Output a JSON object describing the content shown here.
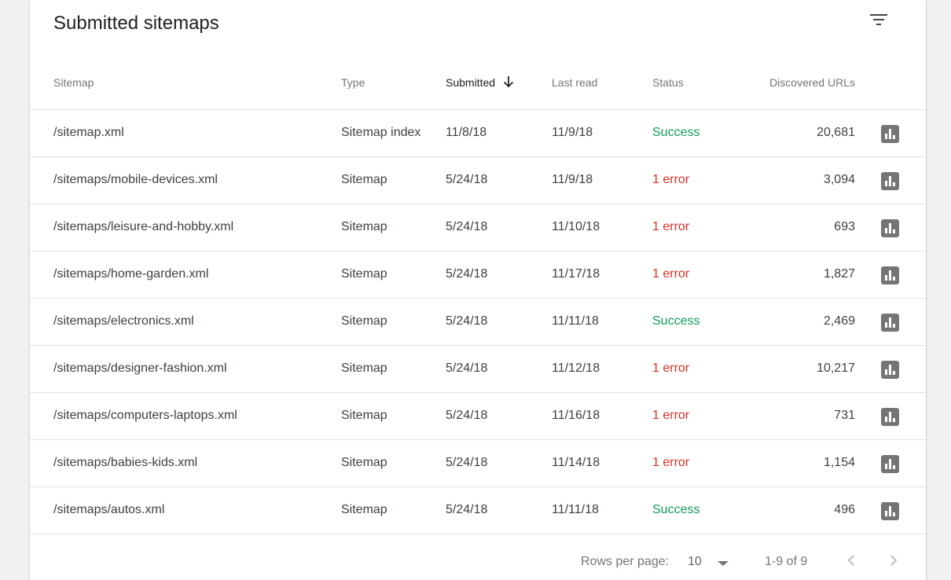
{
  "card": {
    "title": "Submitted sitemaps"
  },
  "columns": {
    "sitemap": "Sitemap",
    "type": "Type",
    "submitted": "Submitted",
    "last_read": "Last read",
    "status": "Status",
    "discovered_urls": "Discovered URLs"
  },
  "rows": [
    {
      "sitemap": "/sitemap.xml",
      "type": "Sitemap index",
      "submitted": "11/8/18",
      "last_read": "11/9/18",
      "status": "Success",
      "urls": "20,681"
    },
    {
      "sitemap": "/sitemaps/mobile-devices.xml",
      "type": "Sitemap",
      "submitted": "5/24/18",
      "last_read": "11/9/18",
      "status": "1 error",
      "urls": "3,094"
    },
    {
      "sitemap": "/sitemaps/leisure-and-hobby.xml",
      "type": "Sitemap",
      "submitted": "5/24/18",
      "last_read": "11/10/18",
      "status": "1 error",
      "urls": "693"
    },
    {
      "sitemap": "/sitemaps/home-garden.xml",
      "type": "Sitemap",
      "submitted": "5/24/18",
      "last_read": "11/17/18",
      "status": "1 error",
      "urls": "1,827"
    },
    {
      "sitemap": "/sitemaps/electronics.xml",
      "type": "Sitemap",
      "submitted": "5/24/18",
      "last_read": "11/11/18",
      "status": "Success",
      "urls": "2,469"
    },
    {
      "sitemap": "/sitemaps/designer-fashion.xml",
      "type": "Sitemap",
      "submitted": "5/24/18",
      "last_read": "11/12/18",
      "status": "1 error",
      "urls": "10,217"
    },
    {
      "sitemap": "/sitemaps/computers-laptops.xml",
      "type": "Sitemap",
      "submitted": "5/24/18",
      "last_read": "11/16/18",
      "status": "1 error",
      "urls": "731"
    },
    {
      "sitemap": "/sitemaps/babies-kids.xml",
      "type": "Sitemap",
      "submitted": "5/24/18",
      "last_read": "11/14/18",
      "status": "1 error",
      "urls": "1,154"
    },
    {
      "sitemap": "/sitemaps/autos.xml",
      "type": "Sitemap",
      "submitted": "5/24/18",
      "last_read": "11/11/18",
      "status": "Success",
      "urls": "496"
    }
  ],
  "footer": {
    "rows_per_page_label": "Rows per page:",
    "rows_per_page_value": "10",
    "range_label": "1-9 of 9"
  },
  "icons": {
    "filter": "filter-icon",
    "sort": "arrow-down-icon",
    "row_action": "bar-chart-icon",
    "dropdown": "caret-down-icon",
    "prev": "chevron-left-icon",
    "next": "chevron-right-icon"
  },
  "colors": {
    "success": "#0f9d58",
    "error": "#d93025",
    "icon_gray": "#757575"
  }
}
